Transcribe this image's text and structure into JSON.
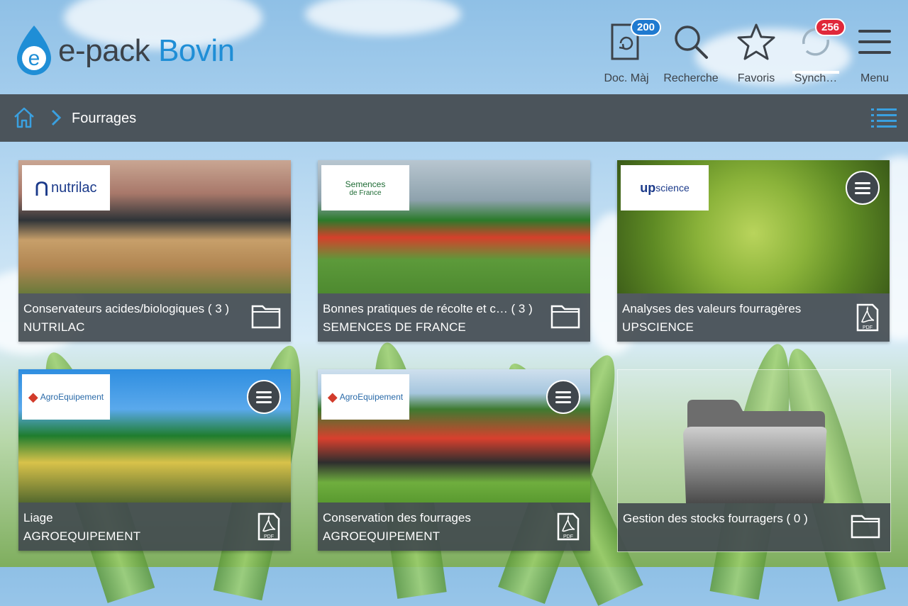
{
  "app": {
    "logo_letter": "e",
    "logo_text_1": "e-pack",
    "logo_text_2": "Bovin"
  },
  "header": {
    "nav": [
      {
        "id": "docmaj",
        "label": "Doc. Màj",
        "badge": "200",
        "badge_color": "#1f7ad0",
        "icon": "document-sync-icon"
      },
      {
        "id": "recherche",
        "label": "Recherche",
        "icon": "search-icon"
      },
      {
        "id": "favoris",
        "label": "Favoris",
        "icon": "star-icon"
      },
      {
        "id": "synch",
        "label": "Synch…",
        "badge": "256",
        "badge_color": "#e0283a",
        "icon": "sync-icon"
      },
      {
        "id": "menu",
        "label": "Menu",
        "icon": "hamburger-icon"
      }
    ]
  },
  "breadcrumb": {
    "home_icon": "home-icon",
    "current": "Fourrages",
    "view_icon": "list-view-icon"
  },
  "tiles": [
    {
      "title": "Conservateurs acides/biologiques ( 3 )",
      "subtitle": "NUTRILAC",
      "brand": "nutrilac",
      "type_icon": "folder-icon",
      "has_menu": false
    },
    {
      "title": "Bonnes pratiques de récolte et c…   ( 3 )",
      "subtitle": "SEMENCES DE FRANCE",
      "brand_1": "Semences",
      "brand_2": "de France",
      "type_icon": "folder-icon",
      "has_menu": false
    },
    {
      "title": "Analyses des valeurs fourragères",
      "subtitle": "UPSCIENCE",
      "brand_1": "up",
      "brand_2": "science",
      "type_icon": "pdf-icon",
      "type_label": "PDF",
      "has_menu": true
    },
    {
      "title": "Liage",
      "subtitle": "AGROEQUIPEMENT",
      "brand": "AgroEquipement",
      "type_icon": "pdf-icon",
      "type_label": "PDF",
      "has_menu": true
    },
    {
      "title": "Conservation des fourrages",
      "subtitle": "AGROEQUIPEMENT",
      "brand": "AgroEquipement",
      "type_icon": "pdf-icon",
      "type_label": "PDF",
      "has_menu": true
    },
    {
      "title": "Gestion des stocks fourragers ( 0 )",
      "subtitle": "",
      "type_icon": "folder-icon",
      "has_menu": false
    }
  ],
  "colors": {
    "accent": "#1f8ed6",
    "bar": "#4b545b"
  }
}
